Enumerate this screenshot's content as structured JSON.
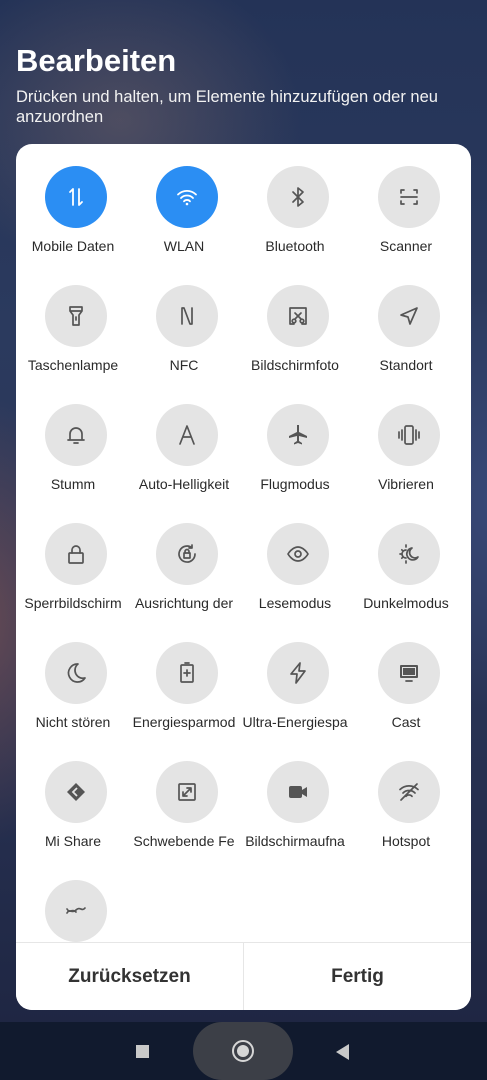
{
  "header": {
    "title": "Bearbeiten",
    "subtitle": "Drücken und halten, um Elemente hinzuzufügen oder neu anzuordnen"
  },
  "tiles": [
    {
      "label": "Mobile Daten",
      "icon": "mobile-data-icon",
      "active": true
    },
    {
      "label": "WLAN",
      "icon": "wifi-icon",
      "active": true
    },
    {
      "label": "Bluetooth",
      "icon": "bluetooth-icon",
      "active": false
    },
    {
      "label": "Scanner",
      "icon": "scanner-icon",
      "active": false
    },
    {
      "label": "Taschenlampe",
      "icon": "flashlight-icon",
      "active": false
    },
    {
      "label": "NFC",
      "icon": "nfc-icon",
      "active": false
    },
    {
      "label": "Bildschirmfoto",
      "icon": "screenshot-icon",
      "active": false
    },
    {
      "label": "Standort",
      "icon": "location-icon",
      "active": false
    },
    {
      "label": "Stumm",
      "icon": "bell-icon",
      "active": false
    },
    {
      "label": "Auto-Helligkeit",
      "icon": "auto-brightness-icon",
      "active": false
    },
    {
      "label": "Flugmodus",
      "icon": "airplane-icon",
      "active": false
    },
    {
      "label": "Vibrieren",
      "icon": "vibrate-icon",
      "active": false
    },
    {
      "label": "Sperrbildschirm",
      "icon": "lock-icon",
      "active": false
    },
    {
      "label": "Ausrichtung der",
      "icon": "rotation-lock-icon",
      "active": false
    },
    {
      "label": "Lesemodus",
      "icon": "eye-icon",
      "active": false
    },
    {
      "label": "Dunkelmodus",
      "icon": "dark-mode-icon",
      "active": false
    },
    {
      "label": "Nicht stören",
      "icon": "moon-icon",
      "active": false
    },
    {
      "label": "Energiesparmod",
      "icon": "battery-saver-icon",
      "active": false
    },
    {
      "label": "Ultra-Energiespa",
      "icon": "lightning-icon",
      "active": false
    },
    {
      "label": "Cast",
      "icon": "cast-icon",
      "active": false
    },
    {
      "label": "Mi Share",
      "icon": "mi-share-icon",
      "active": false
    },
    {
      "label": "Schwebende Fe",
      "icon": "floating-window-icon",
      "active": false
    },
    {
      "label": "Bildschirmaufna",
      "icon": "screen-recorder-icon",
      "active": false
    },
    {
      "label": "Hotspot",
      "icon": "hotspot-icon",
      "active": false
    },
    {
      "label": "",
      "icon": "wave-icon",
      "active": false
    }
  ],
  "footer": {
    "reset_label": "Zurücksetzen",
    "done_label": "Fertig"
  },
  "colors": {
    "active": "#2b8ef3",
    "inactive": "#e4e4e4"
  }
}
